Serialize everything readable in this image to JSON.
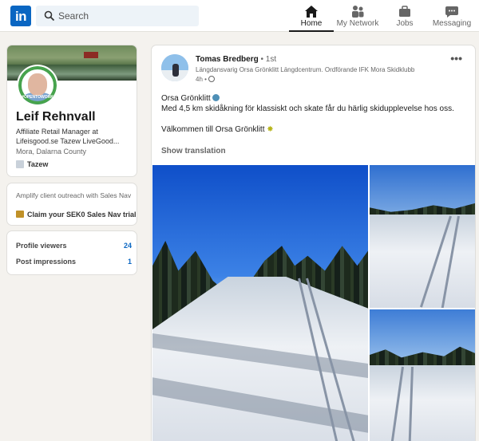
{
  "nav": {
    "search_placeholder": "Search",
    "items": [
      {
        "label": "Home",
        "icon": "home-icon",
        "active": true
      },
      {
        "label": "My Network",
        "icon": "network-icon",
        "active": false
      },
      {
        "label": "Jobs",
        "icon": "briefcase-icon",
        "active": false
      },
      {
        "label": "Messaging",
        "icon": "messaging-icon",
        "active": false
      }
    ]
  },
  "profile": {
    "name": "Leif Rehnvall",
    "headline": "Affiliate Retail Manager at Lifeisgood.se Tazew LiveGood...",
    "location": "Mora, Dalarna County",
    "company": "Tazew",
    "badge": "#OPENTOWORK"
  },
  "promo": {
    "text": "Amplify client outreach with Sales Nav",
    "link": "Claim your SEK0 Sales Nav trial"
  },
  "stats": [
    {
      "label": "Profile viewers",
      "value": "24"
    },
    {
      "label": "Post impressions",
      "value": "1"
    }
  ],
  "post": {
    "author": "Tomas Bredberg",
    "degree": "• 1st",
    "headline": "Längdansvarig Orsa Grönklitt Längdcentrum. Ordförande IFK Mora Skidklubb",
    "time": "4h •",
    "line1": "Orsa Grönklitt",
    "line2": "Med 4,5 km skidåkning för klassiskt och skate får du härlig skidupplevelse hos oss.",
    "line3": "Välkommen till Orsa Grönklitt",
    "show_translation": "Show translation",
    "more": "•••"
  },
  "colors": {
    "brand": "#0a66c2",
    "background": "#f4f2ee",
    "open_to_work": "#47a34d"
  }
}
